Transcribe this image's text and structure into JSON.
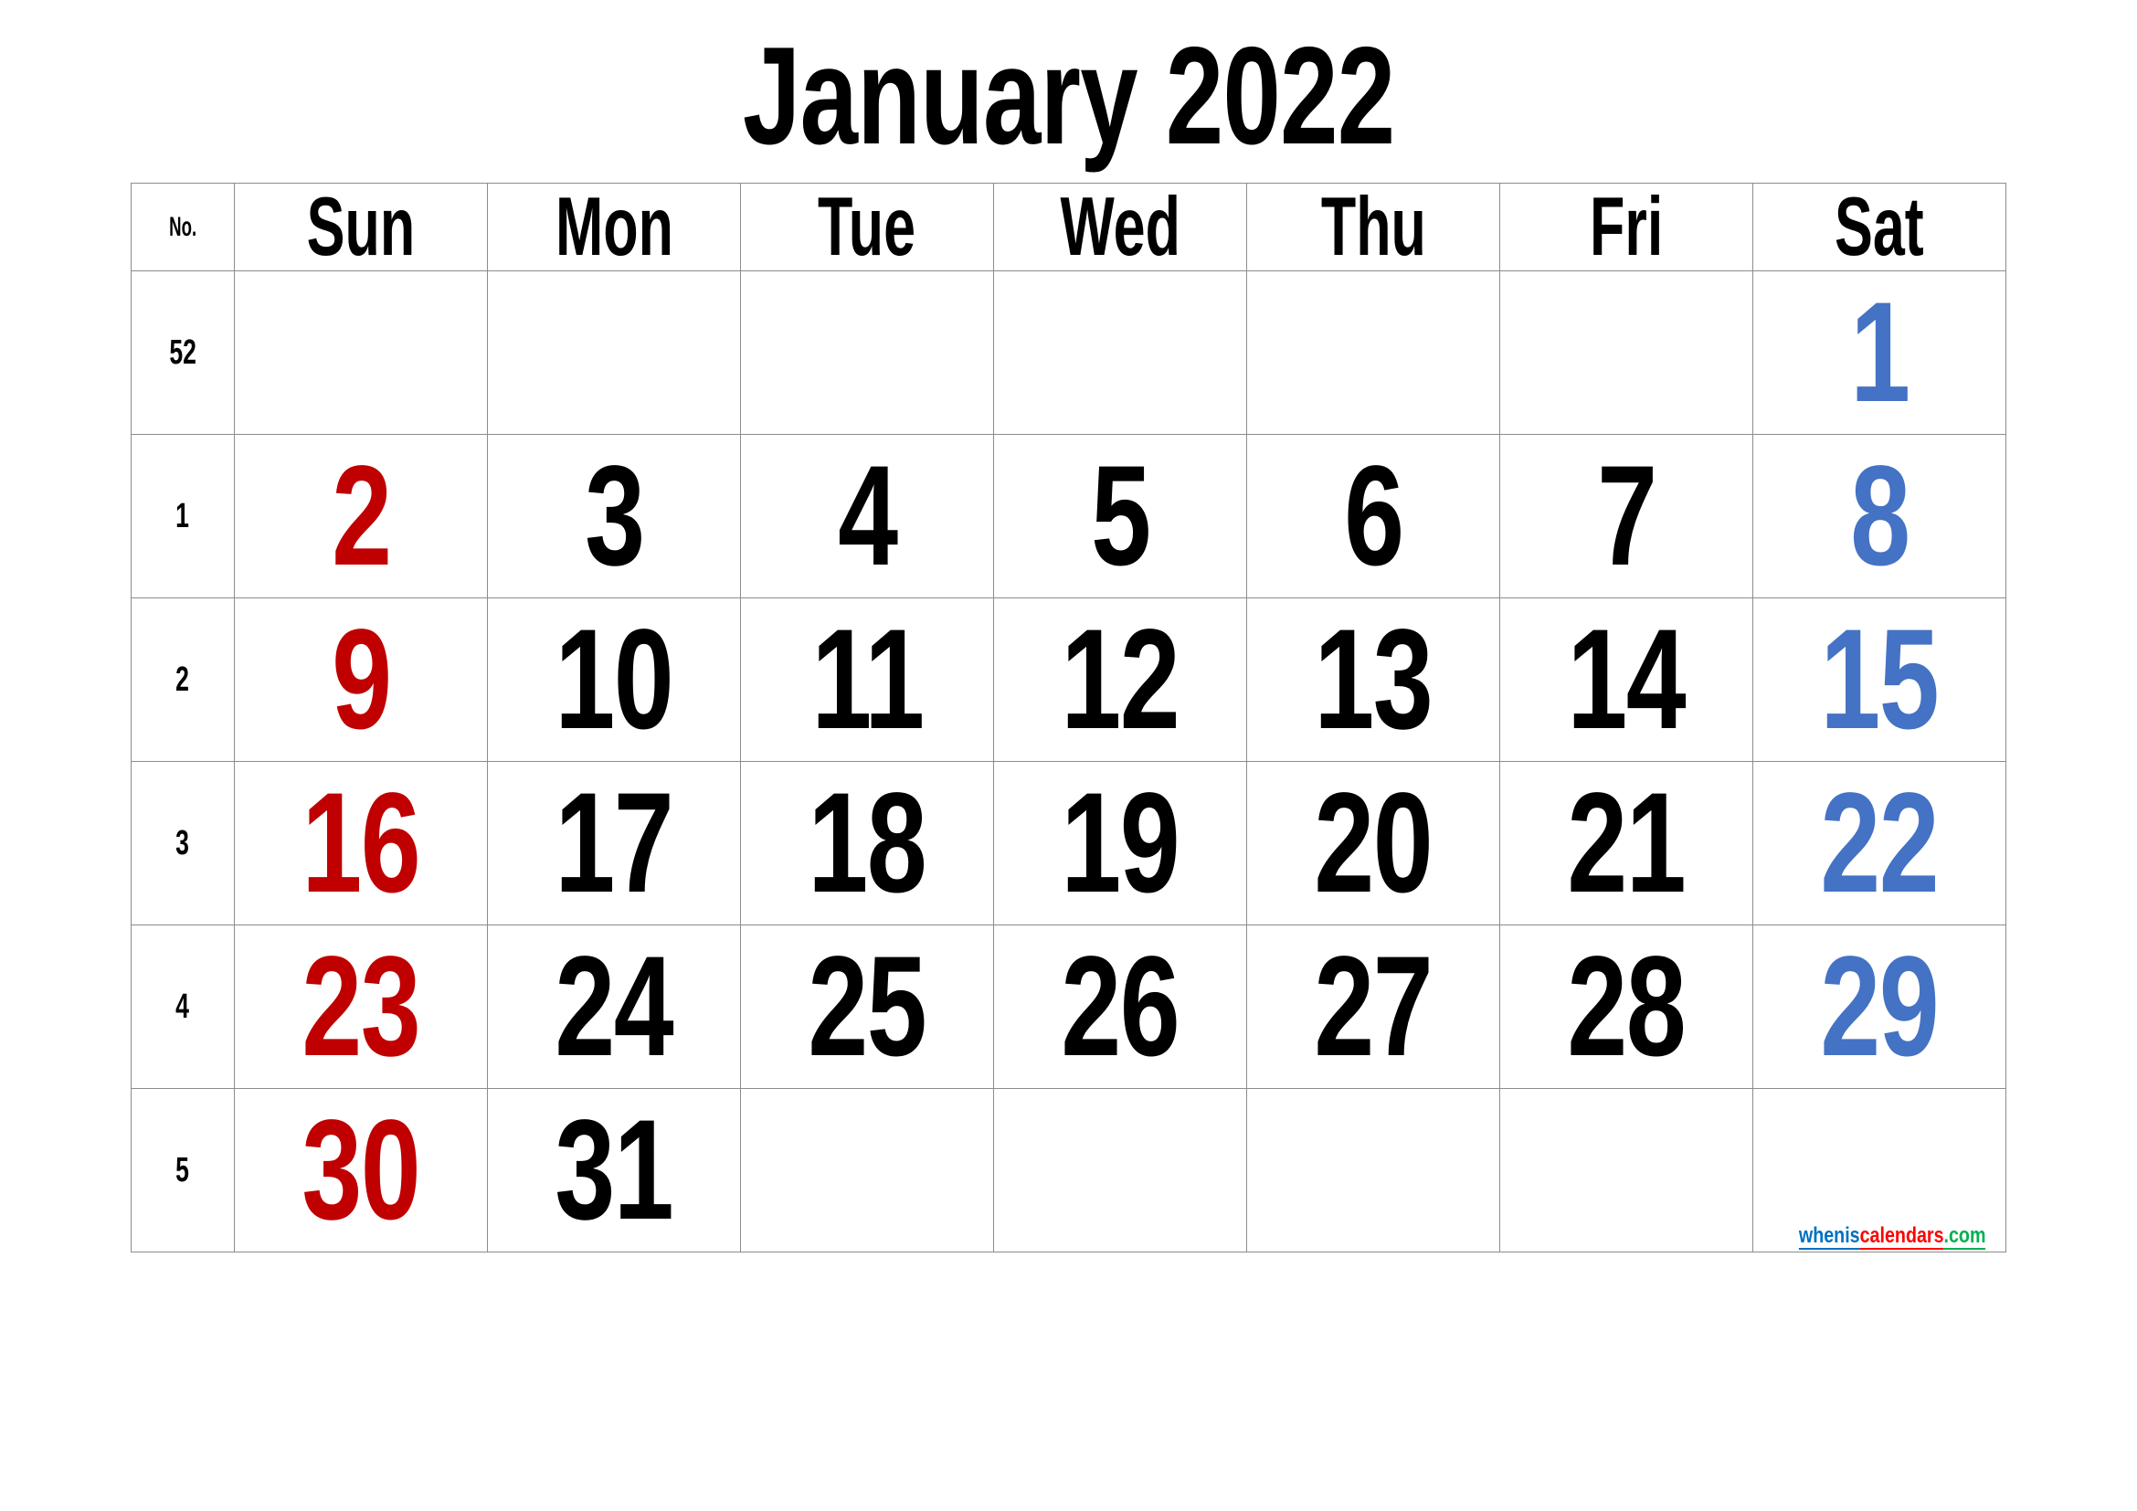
{
  "title": "January 2022",
  "header": {
    "week_no_label": "No.",
    "days": [
      "Sun",
      "Mon",
      "Tue",
      "Wed",
      "Thu",
      "Fri",
      "Sat"
    ]
  },
  "colors": {
    "sunday": "#C00000",
    "saturday": "#4472C4",
    "weekday": "#000000",
    "grid": "#8C8C8C"
  },
  "weeks": [
    {
      "no": "52",
      "days": [
        "",
        "",
        "",
        "",
        "",
        "",
        "1"
      ]
    },
    {
      "no": "1",
      "days": [
        "2",
        "3",
        "4",
        "5",
        "6",
        "7",
        "8"
      ]
    },
    {
      "no": "2",
      "days": [
        "9",
        "10",
        "11",
        "12",
        "13",
        "14",
        "15"
      ]
    },
    {
      "no": "3",
      "days": [
        "16",
        "17",
        "18",
        "19",
        "20",
        "21",
        "22"
      ]
    },
    {
      "no": "4",
      "days": [
        "23",
        "24",
        "25",
        "26",
        "27",
        "28",
        "29"
      ]
    },
    {
      "no": "5",
      "days": [
        "30",
        "31",
        "",
        "",
        "",
        "",
        ""
      ]
    }
  ],
  "watermark": {
    "part1": "whenis",
    "part2": "calendars",
    "part3": ".com"
  }
}
